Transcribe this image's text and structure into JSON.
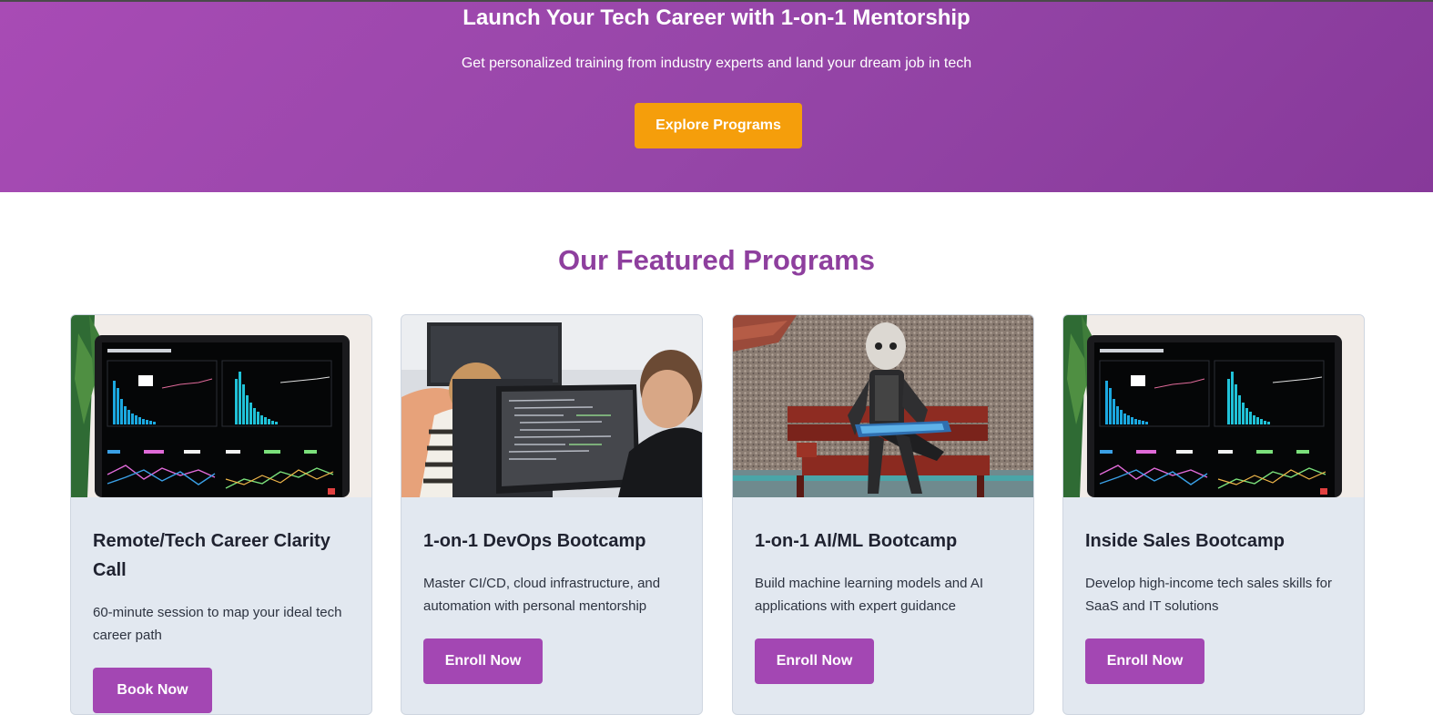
{
  "hero": {
    "title": "Launch Your Tech Career with 1-on-1 Mentorship",
    "subtitle": "Get personalized training from industry experts and land your dream job in tech",
    "cta_label": "Explore Programs"
  },
  "programs": {
    "heading": "Our Featured Programs",
    "cards": [
      {
        "image": "analytics-dashboard-laptop",
        "title": "Remote/Tech Career Clarity Call",
        "description": "60-minute session to map your ideal tech career path",
        "button_label": "Book Now"
      },
      {
        "image": "developers-at-monitors",
        "title": "1-on-1 DevOps Bootcamp",
        "description": "Master CI/CD, cloud infrastructure, and automation with personal mentorship",
        "button_label": "Enroll Now"
      },
      {
        "image": "robot-on-bench-with-tablet",
        "title": "1-on-1 AI/ML Bootcamp",
        "description": "Build machine learning models and AI applications with expert guidance",
        "button_label": "Enroll Now"
      },
      {
        "image": "analytics-dashboard-laptop",
        "title": "Inside Sales Bootcamp",
        "description": "Develop high-income tech sales skills for SaaS and IT solutions",
        "button_label": "Enroll Now"
      }
    ]
  },
  "colors": {
    "hero_gradient_start": "#a84bb5",
    "hero_gradient_end": "#87399a",
    "cta_orange": "#f59e0b",
    "heading_purple": "#8e3f9e",
    "card_button_purple": "#a347b3",
    "card_background": "#e2e8f0"
  }
}
